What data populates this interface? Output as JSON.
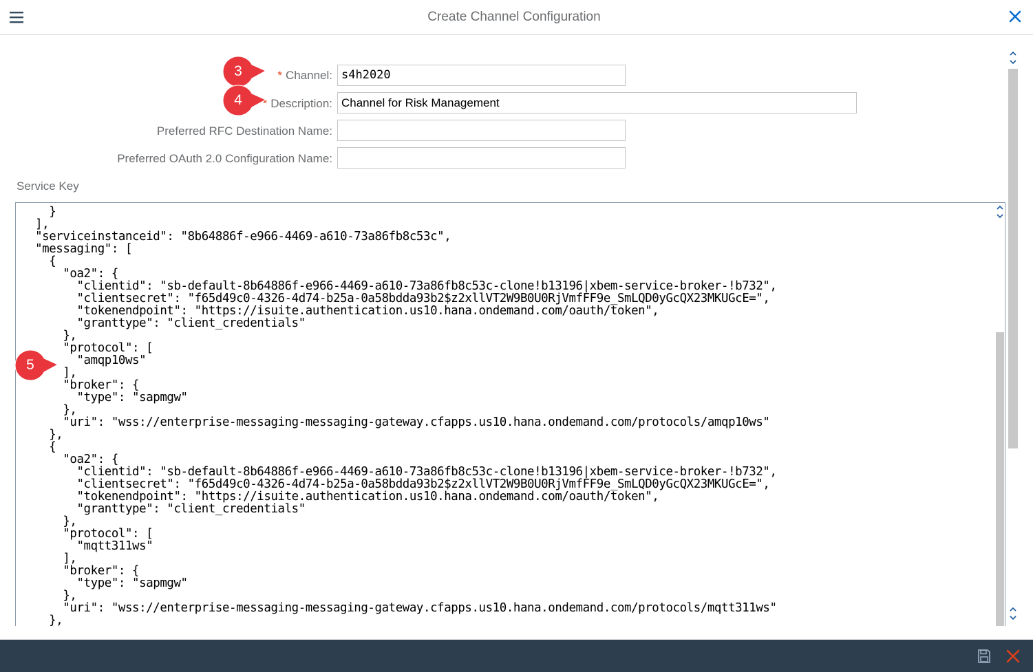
{
  "header": {
    "title": "Create Channel Configuration"
  },
  "form": {
    "channel_label": "Channel:",
    "channel_required": "*",
    "channel_value": "s4h2020",
    "description_label": "Description:",
    "description_required": "*",
    "description_value": "Channel for Risk Management",
    "rfc_label": "Preferred RFC Destination Name:",
    "rfc_value": "",
    "oauth_label": "Preferred OAuth 2.0 Configuration Name:",
    "oauth_value": ""
  },
  "service_key": {
    "label": "Service Key",
    "text": "   }\n ],\n \"serviceinstanceid\": \"8b64886f-e966-4469-a610-73a86fb8c53c\",\n \"messaging\": [\n   {\n     \"oa2\": {\n       \"clientid\": \"sb-default-8b64886f-e966-4469-a610-73a86fb8c53c-clone!b13196|xbem-service-broker-!b732\",\n       \"clientsecret\": \"f65d49c0-4326-4d74-b25a-0a58bdda93b2$z2xllVT2W9B0U0RjVmfFF9e_SmLQD0yGcQX23MKUGcE=\",\n       \"tokenendpoint\": \"https://isuite.authentication.us10.hana.ondemand.com/oauth/token\",\n       \"granttype\": \"client_credentials\"\n     },\n     \"protocol\": [\n       \"amqp10ws\"\n     ],\n     \"broker\": {\n       \"type\": \"sapmgw\"\n     },\n     \"uri\": \"wss://enterprise-messaging-messaging-gateway.cfapps.us10.hana.ondemand.com/protocols/amqp10ws\"\n   },\n   {\n     \"oa2\": {\n       \"clientid\": \"sb-default-8b64886f-e966-4469-a610-73a86fb8c53c-clone!b13196|xbem-service-broker-!b732\",\n       \"clientsecret\": \"f65d49c0-4326-4d74-b25a-0a58bdda93b2$z2xllVT2W9B0U0RjVmfFF9e_SmLQD0yGcQX23MKUGcE=\",\n       \"tokenendpoint\": \"https://isuite.authentication.us10.hana.ondemand.com/oauth/token\",\n       \"granttype\": \"client_credentials\"\n     },\n     \"protocol\": [\n       \"mqtt311ws\"\n     ],\n     \"broker\": {\n       \"type\": \"sapmgw\"\n     },\n     \"uri\": \"wss://enterprise-messaging-messaging-gateway.cfapps.us10.hana.ondemand.com/protocols/mqtt311ws\"\n   },"
  },
  "markers": {
    "m3": "3",
    "m4": "4",
    "m5": "5"
  },
  "icons": {
    "menu": "hamburger-menu-icon",
    "close": "close-icon",
    "save": "save-icon",
    "cancel": "cancel-icon",
    "scroll_up_down": "chevron-up-down-icon"
  },
  "colors": {
    "footer": "#2d3e4e",
    "accent": "#0a6ed1",
    "required": "#e0401a",
    "marker": "#e8363c",
    "cancel": "#e0401a"
  }
}
